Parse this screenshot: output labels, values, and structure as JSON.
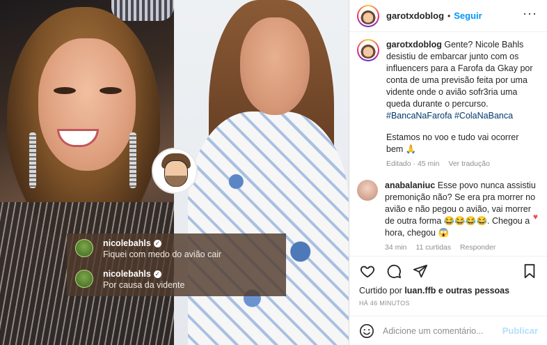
{
  "header": {
    "username": "garotxdoblog",
    "separator": "•",
    "follow_label": "Seguir",
    "more_label": "···"
  },
  "overlay_comments": [
    {
      "user": "nicolebahls",
      "text": "Fiquei com medo do avião cair"
    },
    {
      "user": "nicolebahls",
      "text": "Por causa da vidente"
    }
  ],
  "caption": {
    "user": "garotxdoblog",
    "text": "Gente? Nicole Bahls desistiu de embarcar junto com os influencers para a Farofa da Gkay por conta de uma previsão feita por uma vidente onde o avião sofr3ria uma queda durante o percurso.",
    "hashtags": "#BancaNaFarofa #ColaNaBanca",
    "text2": "Estamos no voo e tudo vai ocorrer bem 🙏",
    "meta_edited": "Editado · 45 min",
    "meta_translate": "Ver tradução"
  },
  "comment": {
    "user": "anabalaniuc",
    "text": "Esse povo nunca assistiu premonição não? Se era pra morrer no avião e não pegou o avião, vai morrer de outra forma 😂😂😂😂. Chegou a hora, chegou 😱",
    "meta_time": "34 min",
    "meta_likes": "11 curtidas",
    "meta_reply": "Responder"
  },
  "actions": {
    "liked_prefix": "Curtido por ",
    "liked_user": "luan.ffb",
    "liked_suffix": " e outras pessoas",
    "time_ago": "HÁ 46 MINUTOS"
  },
  "add_comment": {
    "placeholder": "Adicione um comentário...",
    "publish_label": "Publicar"
  },
  "colors": {
    "follow_blue": "#0095f6",
    "publish_disabled": "#b2dffc",
    "heart_red": "#ed4956",
    "hashtag_blue": "#00376b"
  }
}
